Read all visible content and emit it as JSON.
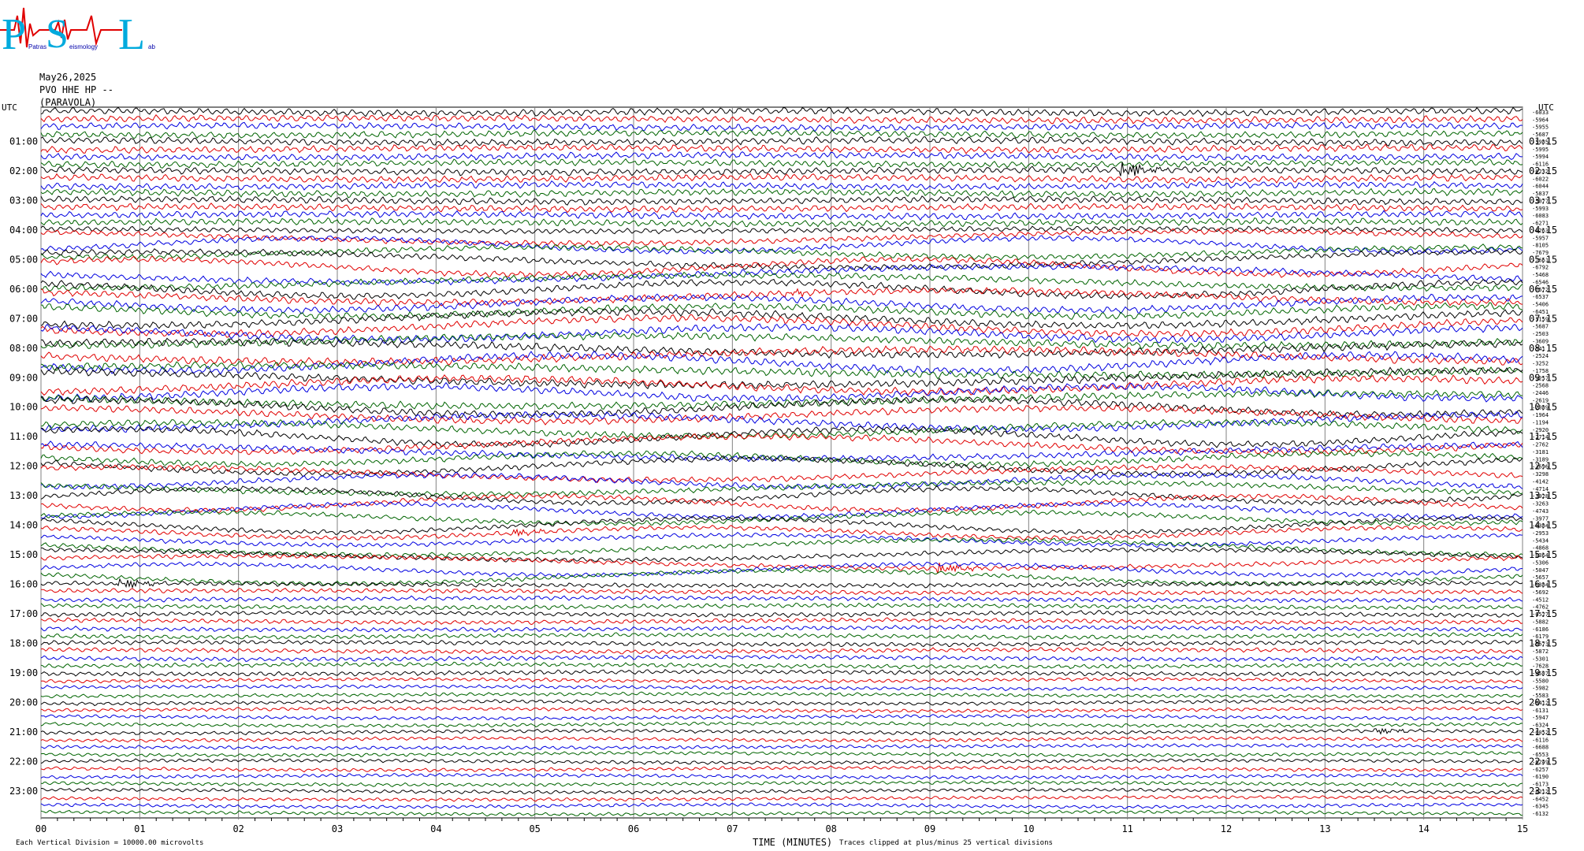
{
  "logo": {
    "letters": [
      "P",
      "S",
      "L"
    ],
    "subtitle_a": "Patras",
    "subtitle_b": "eismology",
    "subtitle_c": "ab"
  },
  "header": {
    "date": "May26,2025",
    "station": "PVO HHE HP --",
    "location": "(PARAVOLA)"
  },
  "axis": {
    "left_title": "UTC",
    "right_title": "UTC",
    "xlabel": "TIME (MINUTES)",
    "x_ticks": [
      "00",
      "01",
      "02",
      "03",
      "04",
      "05",
      "06",
      "07",
      "08",
      "09",
      "10",
      "11",
      "12",
      "13",
      "14",
      "15"
    ],
    "left_hours": [
      "01:00",
      "02:00",
      "03:00",
      "04:00",
      "05:00",
      "06:00",
      "07:00",
      "08:00",
      "09:00",
      "10:00",
      "11:00",
      "12:00",
      "13:00",
      "14:00",
      "15:00",
      "16:00",
      "17:00",
      "18:00",
      "19:00",
      "20:00",
      "21:00",
      "22:00",
      "23:00"
    ],
    "right_hours": [
      "01:15",
      "02:15",
      "03:15",
      "04:15",
      "05:15",
      "06:15",
      "07:15",
      "08:15",
      "09:15",
      "10:15",
      "11:15",
      "12:15",
      "13:15",
      "14:15",
      "15:15",
      "16:15",
      "17:15",
      "18:15",
      "19:15",
      "20:15",
      "21:15",
      "22:15",
      "23:15"
    ]
  },
  "footer": {
    "scale_note": "Each Vertical Division = 10000.00 microvolts",
    "clip_note": "Traces clipped at plus/minus 25 vertical divisions"
  },
  "colors": {
    "trace_cycle": [
      "#000000",
      "#e00000",
      "#0000e0",
      "#006400"
    ],
    "logo_blue": "#00aadd",
    "logo_red": "#e00000"
  },
  "chart_data": {
    "type": "line",
    "title": "",
    "xlabel": "TIME (MINUTES)",
    "ylabel": "UTC",
    "xlim": [
      0,
      15
    ],
    "trace_count": 96,
    "trace_minutes": 15,
    "offsets": [
      -6033,
      -5964,
      -5955,
      -5687,
      -5985,
      -5995,
      -5994,
      -6116,
      -6232,
      -6022,
      -6044,
      -5837,
      -5077,
      -5993,
      -6083,
      -6271,
      -6263,
      -5957,
      -8105,
      -7679,
      -7661,
      -6792,
      -5468,
      -6546,
      -7572,
      -6537,
      -5406,
      -6451,
      -5159,
      -5687,
      -2503,
      -3609,
      -541,
      -2524,
      -3252,
      -1758,
      -3257,
      -2568,
      -2446,
      -2619,
      -2089,
      -1964,
      -1194,
      -2920,
      -2714,
      -2762,
      -3181,
      -3189,
      -3696,
      -3298,
      -4142,
      -4714,
      -3928,
      -3263,
      -4743,
      -3977,
      -6384,
      -2953,
      -5434,
      -4868,
      -6364,
      -5306,
      -5047,
      -5657,
      -6384,
      -5692,
      -4512,
      -4762,
      -6527,
      -5882,
      -6186,
      -6179,
      -6573,
      -5872,
      -5301,
      -7628,
      -4587,
      -5580,
      -5982,
      -5583,
      -6412,
      -6131,
      -5947,
      -6324,
      -6052,
      -6116,
      -6688,
      -6553,
      -6249,
      -6257,
      -6190,
      -6173,
      -6212,
      -6452,
      -6345,
      -6132
    ],
    "events": [
      {
        "trace": 8,
        "minute": 10.95,
        "amplitude": "large"
      },
      {
        "trace": 25,
        "minute": 7.55,
        "amplitude": "small"
      },
      {
        "trace": 61,
        "minute": 9.1,
        "amplitude": "medium"
      },
      {
        "trace": 64,
        "minute": 0.8,
        "amplitude": "medium"
      },
      {
        "trace": 57,
        "minute": 4.8,
        "amplitude": "small"
      },
      {
        "trace": 84,
        "minute": 13.5,
        "amplitude": "small"
      }
    ]
  }
}
